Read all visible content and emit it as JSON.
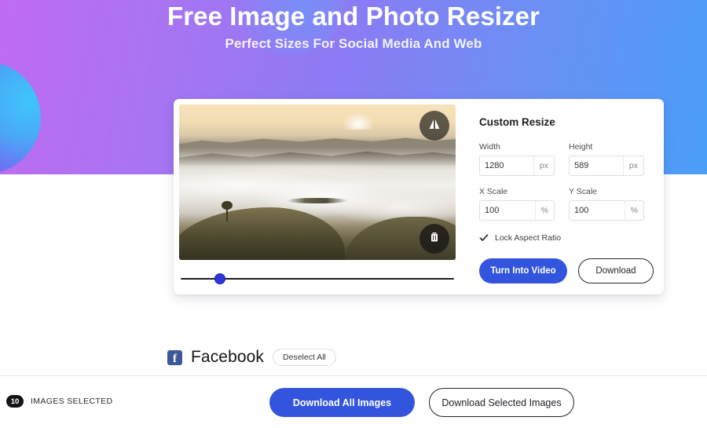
{
  "hero": {
    "title": "Free Image and Photo Resizer",
    "subtitle": "Perfect Sizes For Social Media And Web",
    "gradient_start": "#c06bf0",
    "gradient_end": "#4a9ef6"
  },
  "editor": {
    "photo_alt": "Mountain landscape with sea of fog at sunrise",
    "flip_icon": "flip-horizontal-icon",
    "delete_icon": "trash-icon",
    "slider": {
      "value": 13,
      "min": 0,
      "max": 100
    }
  },
  "form": {
    "title": "Custom Resize",
    "fields": [
      {
        "label": "Width",
        "value": "1280",
        "unit": "px"
      },
      {
        "label": "Height",
        "value": "589",
        "unit": "px"
      },
      {
        "label": "X Scale",
        "value": "100",
        "unit": "%"
      },
      {
        "label": "Y Scale",
        "value": "100",
        "unit": "%"
      }
    ],
    "lock_aspect_label": "Lock Aspect Ratio",
    "lock_aspect_checked": true,
    "primary_button": "Turn Into Video",
    "secondary_button": "Download",
    "primary_color": "#3355dd"
  },
  "platform": {
    "icon": "facebook-icon",
    "icon_letter": "f",
    "icon_color": "#3b5998",
    "name": "Facebook",
    "deselect_label": "Deselect All"
  },
  "bottom_bar": {
    "count": "10",
    "selected_label": "IMAGES SELECTED",
    "download_all_label": "Download All Images",
    "download_selected_label": "Download Selected Images"
  }
}
